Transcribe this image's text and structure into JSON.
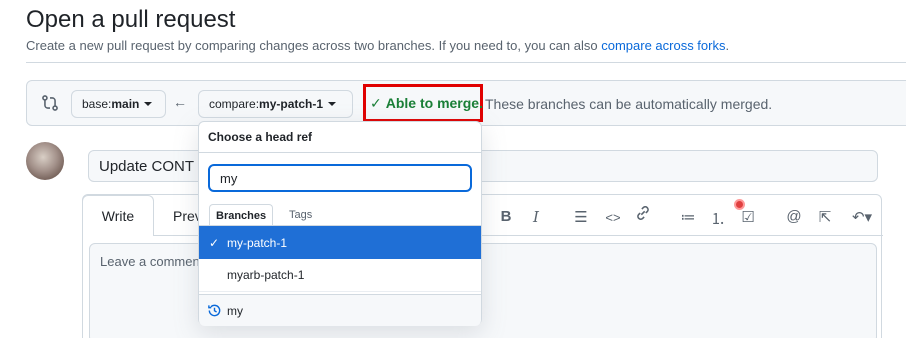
{
  "header": {
    "title": "Open a pull request",
    "subtitle": "Create a new pull request by comparing changes across two branches. If you need to, you can also ",
    "compare_forks_link": "compare across forks",
    "subtitle_end": "."
  },
  "compare_bar": {
    "base_label": "base: ",
    "base_value": "main",
    "arrow": "←",
    "compare_label": "compare: ",
    "compare_value": "my-patch-1",
    "merge_check": "✓",
    "merge_status": "Able to merge.",
    "merge_text": "These branches can be automatically merged."
  },
  "form": {
    "title_value": "Update CONT",
    "tabs": [
      "Write",
      "Prev"
    ],
    "comment_placeholder": "Leave a commen"
  },
  "toolbar": {
    "bold": "B",
    "italic": "I",
    "heading": "☰",
    "code": "<>",
    "link": "🔗",
    "bullet_list": "≔",
    "numbered_list": "⒈",
    "task_list": "☑",
    "mention": "@",
    "reference": "⇱",
    "undo": "↶▾"
  },
  "dropdown": {
    "title": "Choose a head ref",
    "filter_value": "my",
    "tabs": [
      "Branches",
      "Tags"
    ],
    "items": [
      {
        "label": "my-patch-1",
        "selected": true,
        "check": "✓"
      },
      {
        "label": "myarb-patch-1",
        "selected": false
      }
    ],
    "footer": "my"
  },
  "colors": {
    "accent": "#0969da",
    "merge_green": "#1a7f37",
    "highlight_red": "#e00000",
    "selected_bg": "#1f6fd6"
  }
}
